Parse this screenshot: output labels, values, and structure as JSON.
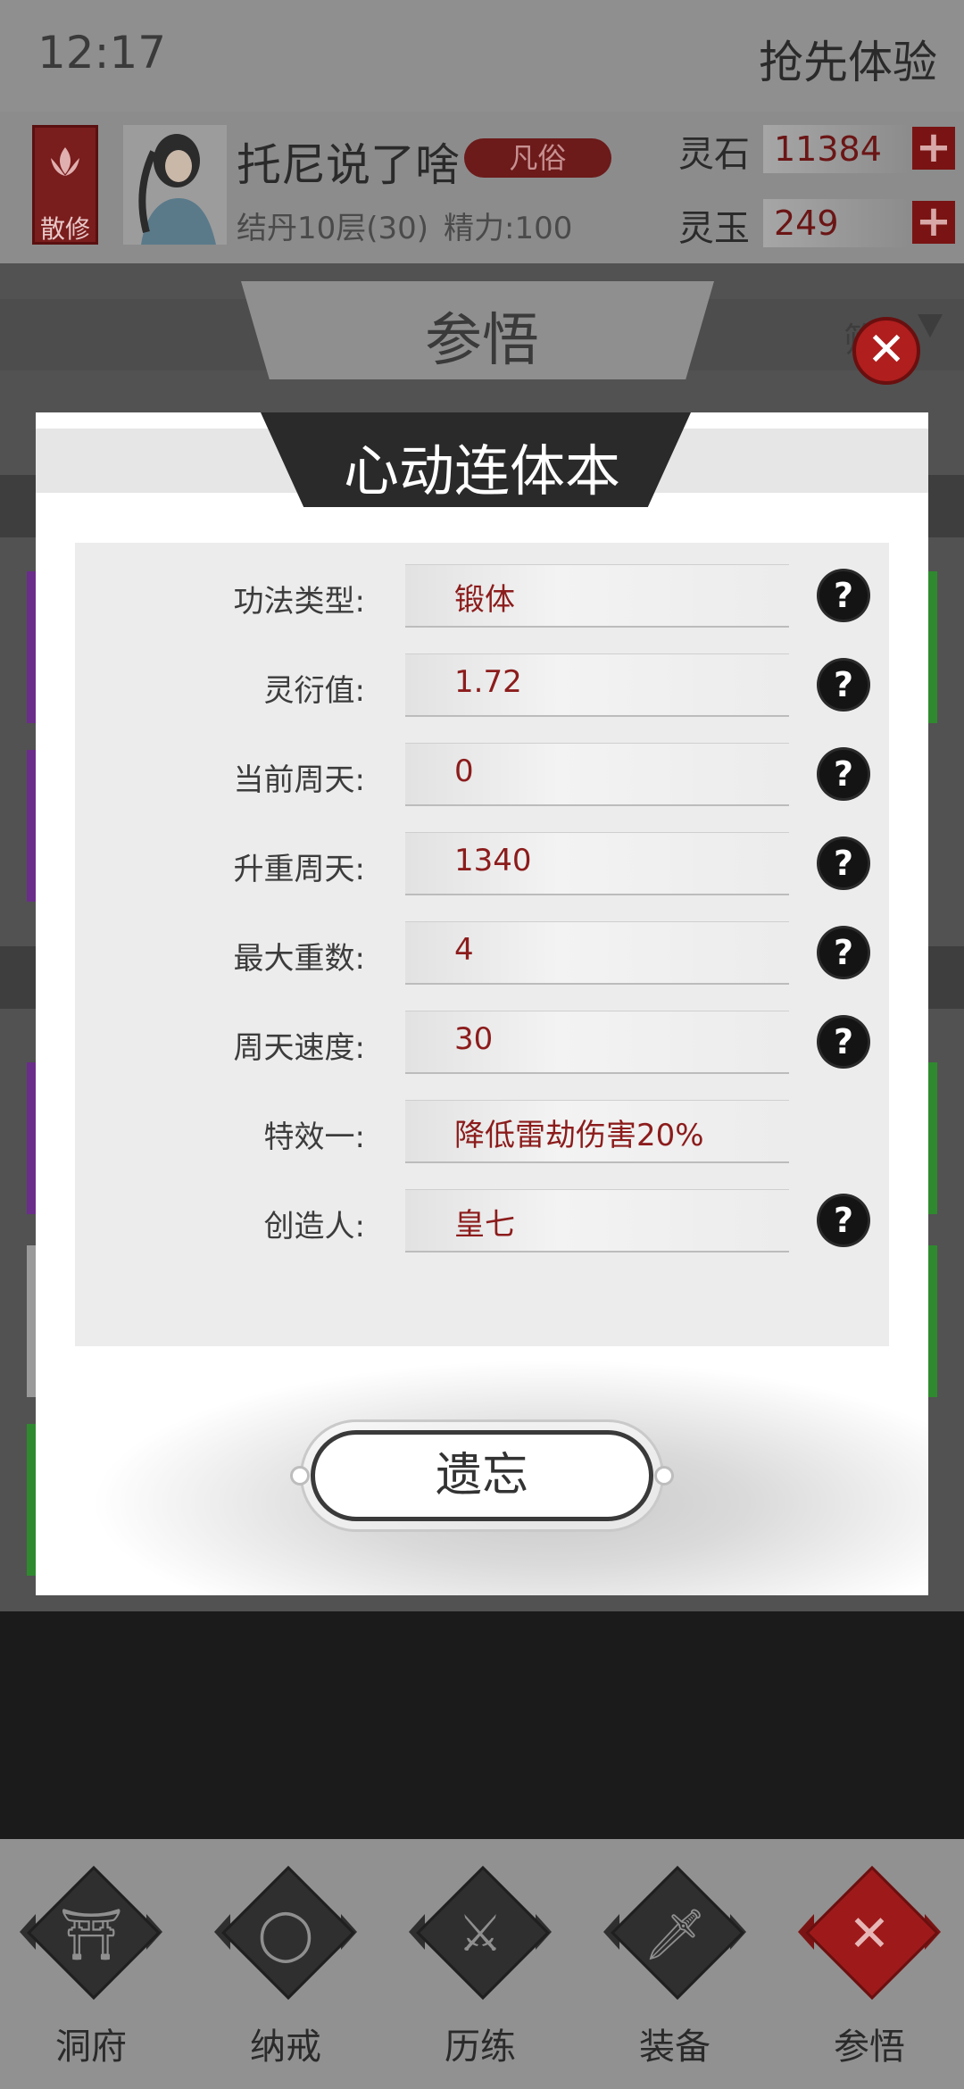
{
  "status_bar": {
    "time": "12:17",
    "early_access": "抢先体验"
  },
  "player": {
    "sect": "散修",
    "name": "托尼说了啥",
    "rank": "凡俗",
    "realm": "结丹10层(30)",
    "energy": "精力:100"
  },
  "resources": [
    {
      "label": "灵石",
      "value": "11384"
    },
    {
      "label": "灵玉",
      "value": "249"
    }
  ],
  "page": {
    "title": "参悟",
    "filter_partial": "筛"
  },
  "modal": {
    "title": "心动连体本",
    "rows": [
      {
        "label": "功法类型:",
        "value": "锻体",
        "help": true
      },
      {
        "label": "灵衍值:",
        "value": "1.72",
        "help": true
      },
      {
        "label": "当前周天:",
        "value": "0",
        "help": true
      },
      {
        "label": "升重周天:",
        "value": "1340",
        "help": true
      },
      {
        "label": "最大重数:",
        "value": "4",
        "help": true
      },
      {
        "label": "周天速度:",
        "value": "30",
        "help": true
      },
      {
        "label": "特效一:",
        "value": "降低雷劫伤害20%",
        "help": false
      },
      {
        "label": "创造人:",
        "value": "皇七",
        "help": true
      }
    ],
    "forget_label": "遗忘"
  },
  "bottom_nav": [
    {
      "label": "洞府",
      "icon": "cave-gate-icon",
      "active": false
    },
    {
      "label": "纳戒",
      "icon": "ring-icon",
      "active": false
    },
    {
      "label": "历练",
      "icon": "crossed-swords-icon",
      "active": false
    },
    {
      "label": "装备",
      "icon": "dagger-icon",
      "active": false
    },
    {
      "label": "参悟",
      "icon": "close-cross-icon",
      "active": true
    }
  ],
  "colors": {
    "accent_red": "#8c1c1c",
    "modal_bg": "#ffffff"
  }
}
